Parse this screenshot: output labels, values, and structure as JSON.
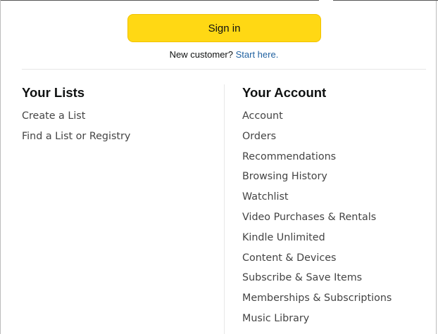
{
  "signin": {
    "button_label": "Sign in",
    "new_customer_text": "New customer?",
    "start_here_link": "Start here."
  },
  "lists": {
    "heading": "Your Lists",
    "items": [
      {
        "label": "Create a List"
      },
      {
        "label": "Find a List or Registry"
      }
    ]
  },
  "account": {
    "heading": "Your Account",
    "items": [
      {
        "label": "Account"
      },
      {
        "label": "Orders"
      },
      {
        "label": "Recommendations"
      },
      {
        "label": "Browsing History"
      },
      {
        "label": "Watchlist"
      },
      {
        "label": "Video Purchases & Rentals"
      },
      {
        "label": "Kindle Unlimited"
      },
      {
        "label": "Content & Devices"
      },
      {
        "label": "Subscribe & Save Items"
      },
      {
        "label": "Memberships & Subscriptions"
      },
      {
        "label": "Music Library"
      }
    ]
  },
  "colors": {
    "button_yellow": "#ffd814",
    "link_blue": "#2162a1",
    "text_dark": "#0f1111",
    "item_gray": "#444444"
  }
}
